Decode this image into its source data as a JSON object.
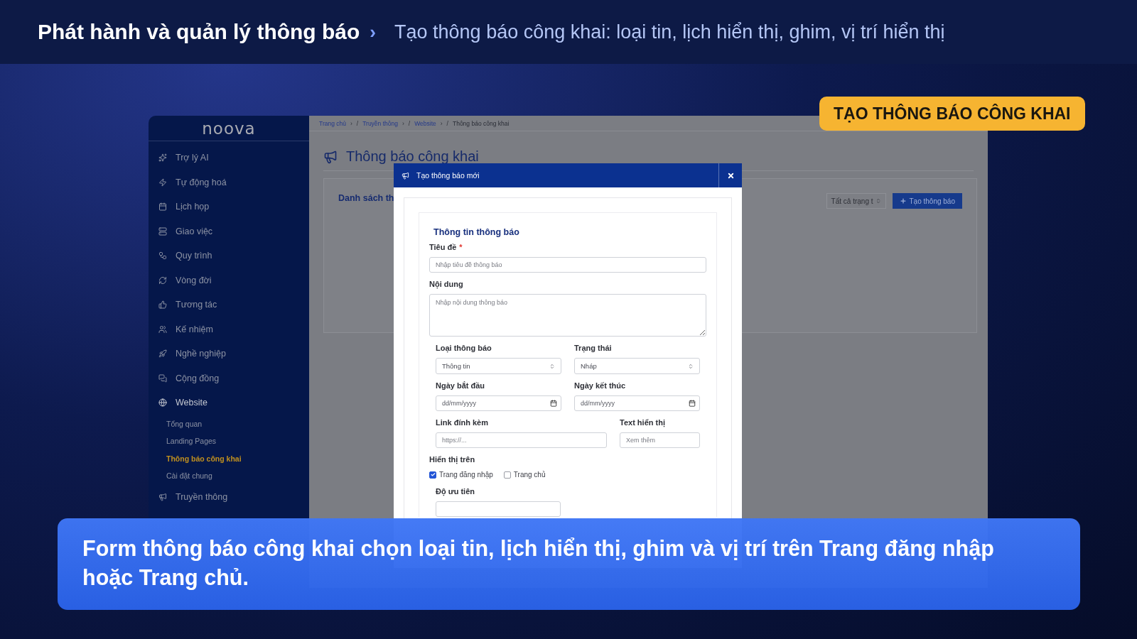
{
  "header": {
    "title": "Phát hành và quản lý thông báo",
    "separator": "›",
    "subtitle": "Tạo thông báo công khai: loại tin, lịch hiển thị, ghim, vị trí hiển thị"
  },
  "badge": "TẠO THÔNG BÁO CÔNG KHAI",
  "app": {
    "logo": "noova",
    "sidebar": {
      "items": [
        {
          "label": "Trợ lý AI",
          "expanded": false
        },
        {
          "label": "Tự động hoá",
          "expanded": false
        },
        {
          "label": "Lịch họp",
          "expanded": false
        },
        {
          "label": "Giao việc",
          "expanded": false
        },
        {
          "label": "Quy trình",
          "expanded": false
        },
        {
          "label": "Vòng đời",
          "expanded": false
        },
        {
          "label": "Tương tác",
          "expanded": false
        },
        {
          "label": "Kế nhiệm",
          "expanded": false
        },
        {
          "label": "Nghề nghiệp",
          "expanded": false
        },
        {
          "label": "Cộng đồng",
          "expanded": false
        },
        {
          "label": "Website",
          "expanded": true,
          "children": [
            {
              "label": "Tổng quan",
              "selected": false
            },
            {
              "label": "Landing Pages",
              "selected": false
            },
            {
              "label": "Thông báo công khai",
              "selected": true
            },
            {
              "label": "Cài đặt chung",
              "selected": false
            }
          ]
        },
        {
          "label": "Truyền thông",
          "expanded": false
        }
      ]
    },
    "breadcrumb": {
      "arrow": "›",
      "slash": "/",
      "items": [
        "Trang chủ",
        "Truyền thông",
        "Website",
        "Thông báo công khai"
      ]
    },
    "page_title": "Thông báo công khai",
    "card_title": "Danh sách th",
    "status_filter": "Tất cả trạng t",
    "create_button": "Tạo thông báo",
    "modal": {
      "title": "Tạo thông báo mới",
      "section_title": "Thông tin thông báo",
      "title_field": {
        "label": "Tiêu đề",
        "required_mark": "*",
        "placeholder": "Nhập tiêu đề thông báo"
      },
      "content_field": {
        "label": "Nội dung",
        "placeholder": "Nhập nội dung thông báo"
      },
      "type_select": {
        "label": "Loại thông báo",
        "value": "Thông tin"
      },
      "status_select": {
        "label": "Trạng thái",
        "value": "Nháp"
      },
      "start_date": {
        "label": "Ngày bắt đầu",
        "placeholder": "dd/mm/yyyy"
      },
      "end_date": {
        "label": "Ngày kết thúc",
        "placeholder": "dd/mm/yyyy"
      },
      "link_field": {
        "label": "Link đính kèm",
        "placeholder": "https://..."
      },
      "display_text_field": {
        "label": "Text hiển thị",
        "placeholder": "Xem thêm"
      },
      "display_on": {
        "label": "Hiển thị trên",
        "options": [
          {
            "label": "Trang đăng nhập",
            "checked": true
          },
          {
            "label": "Trang chủ",
            "checked": false
          }
        ]
      },
      "priority": {
        "label": "Độ ưu tiên"
      }
    }
  },
  "caption": "Form thông báo công khai chọn loại tin, lịch hiển thị, ghim và vị trí trên Trang đăng nhập hoặc Trang chủ."
}
